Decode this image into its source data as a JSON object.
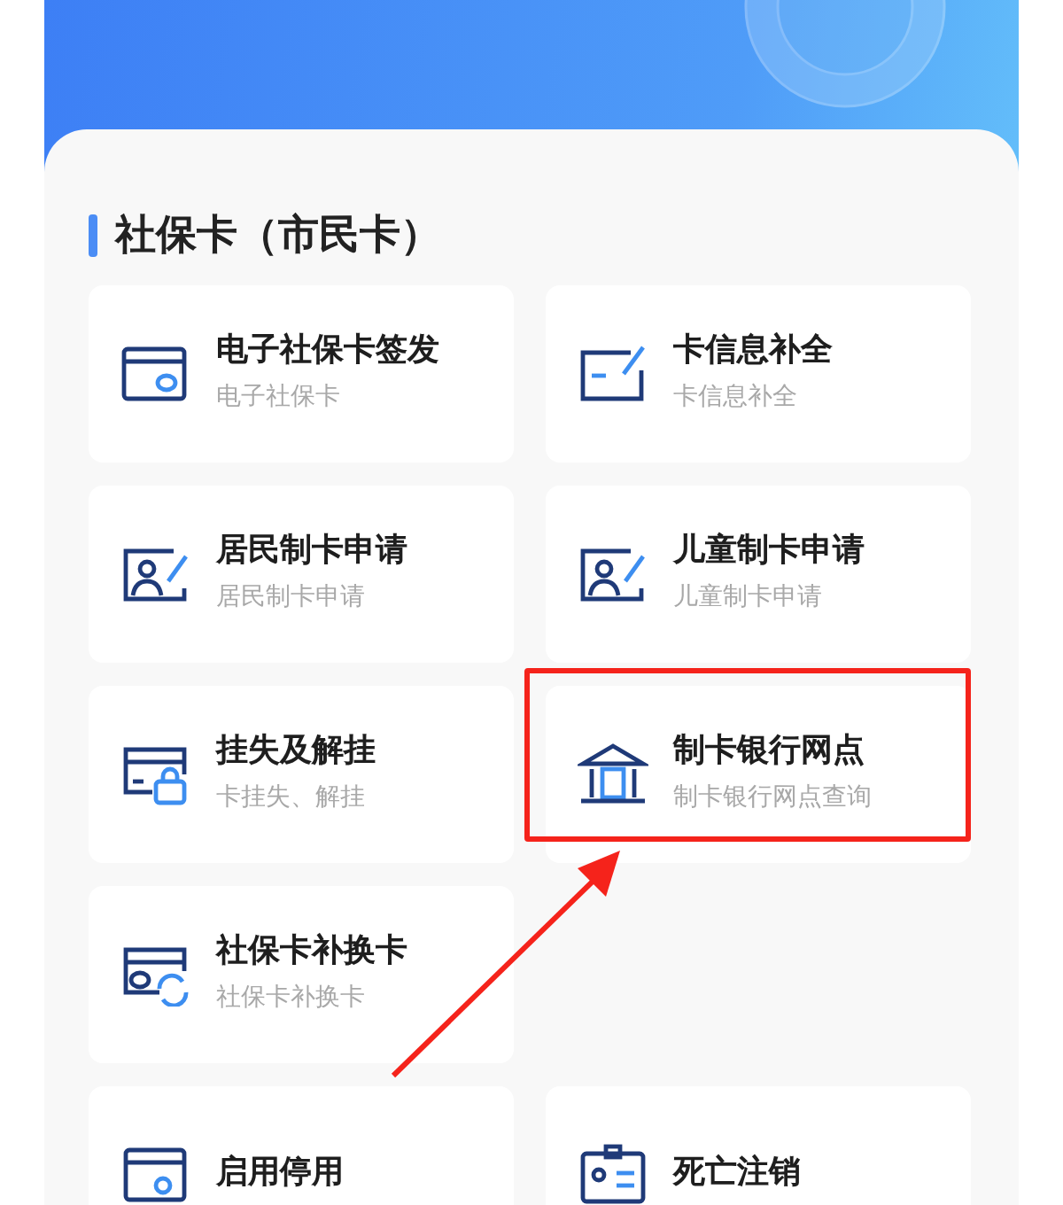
{
  "section": {
    "title": "社保卡（市民卡）"
  },
  "tiles": [
    {
      "kind": "service",
      "title": "电子社保卡签发",
      "subtitle": "电子社保卡",
      "highlighted": false
    },
    {
      "kind": "service",
      "title": "卡信息补全",
      "subtitle": "卡信息补全",
      "highlighted": false
    },
    {
      "kind": "service",
      "title": "居民制卡申请",
      "subtitle": "居民制卡申请",
      "highlighted": false
    },
    {
      "kind": "service",
      "title": "儿童制卡申请",
      "subtitle": "儿童制卡申请",
      "highlighted": false
    },
    {
      "kind": "service",
      "title": "挂失及解挂",
      "subtitle": "卡挂失、解挂",
      "highlighted": false
    },
    {
      "kind": "service",
      "title": "制卡银行网点",
      "subtitle": "制卡银行网点查询",
      "highlighted": true
    },
    {
      "kind": "service",
      "title": "社保卡补换卡",
      "subtitle": "社保卡补换卡",
      "highlighted": false
    },
    {
      "kind": "empty"
    },
    {
      "kind": "service",
      "title": "启用停用",
      "highlighted": false
    },
    {
      "kind": "service",
      "title": "死亡注销",
      "highlighted": false
    }
  ]
}
